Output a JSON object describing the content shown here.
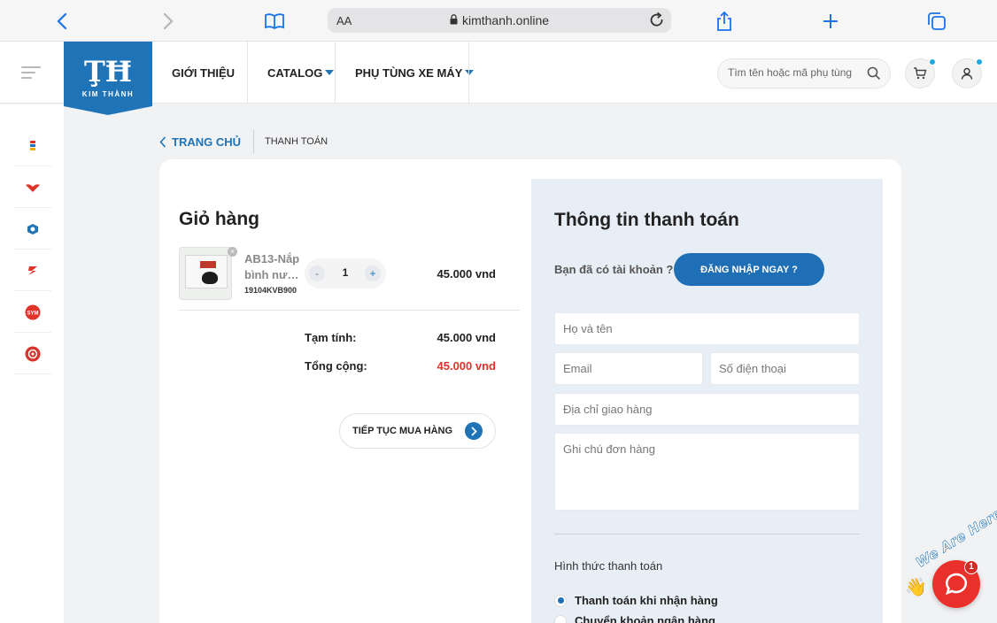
{
  "browser": {
    "address_aa": "AA",
    "url": "kimthanh.online"
  },
  "header": {
    "logo_text": "KIM THÀNH",
    "nav": [
      {
        "label": "GIỚI THIỆU"
      },
      {
        "label": "CATALOG"
      },
      {
        "label": "PHỤ TÙNG XE MÁY"
      }
    ],
    "search_placeholder": "Tìm tên hoặc mã phụ tùng"
  },
  "sidebar": {
    "brands": [
      "brand-1-icon",
      "honda-icon",
      "piaggio-icon",
      "suzuki-icon",
      "sym-icon",
      "yamaha-icon"
    ]
  },
  "breadcrumb": {
    "home": "TRANG CHỦ",
    "current": "THANH TOÁN"
  },
  "cart": {
    "title": "Giỏ hàng",
    "item": {
      "name_line1": "AB13-Nắp",
      "name_line2": "bình nước làm mát",
      "sku": "19104KVB900",
      "qty_minus": "-",
      "qty_plus": "+",
      "quantity": "1",
      "price": "45.000 vnd"
    },
    "subtotal_label": "Tạm tính:",
    "subtotal_value": "45.000 vnd",
    "total_label": "Tổng cộng:",
    "total_value": "45.000 vnd",
    "continue_label": "TIẾP TỤC MUA HÀNG"
  },
  "payment": {
    "title": "Thông tin thanh toán",
    "has_account": "Bạn đã có tài khoản ?",
    "login_label": "ĐĂNG NHẬP NGAY ?",
    "fields": {
      "name": "Họ và tên",
      "email": "Email",
      "phone": "Số điện thoại",
      "address": "Địa chỉ giao hàng",
      "note": "Ghi chú đơn hàng"
    },
    "method_label": "Hình thức thanh toán",
    "methods": [
      "Thanh toán khi nhận hàng",
      "Chuyển khoản ngân hàng"
    ]
  },
  "chat": {
    "tagline": "We Are Here!",
    "badge": "1"
  },
  "colors": {
    "brand_blue": "#1f73b7",
    "total_red": "#e0332a"
  }
}
